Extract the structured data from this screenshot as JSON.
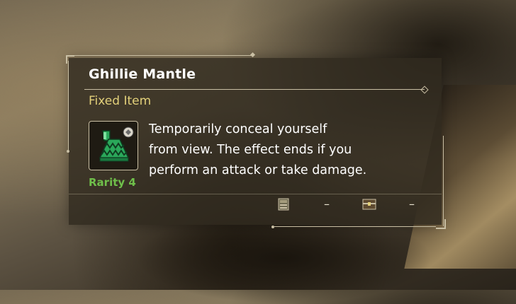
{
  "item": {
    "name": "Ghillie Mantle",
    "type": "Fixed Item",
    "rarity": "Rarity 4",
    "description_lines": [
      "Temporarily conceal yourself",
      "from view. The effect ends if you",
      "perform an attack or take damage."
    ],
    "icon": "ghillie-mantle-icon"
  },
  "stats": [
    {
      "icon": "equipment-box-icon",
      "value": "–"
    },
    {
      "icon": "item-chest-icon",
      "value": "–"
    }
  ],
  "colors": {
    "item_type": "#e2d07a",
    "rarity": "#6fbf4a",
    "icon_green": "#2aa85a"
  }
}
